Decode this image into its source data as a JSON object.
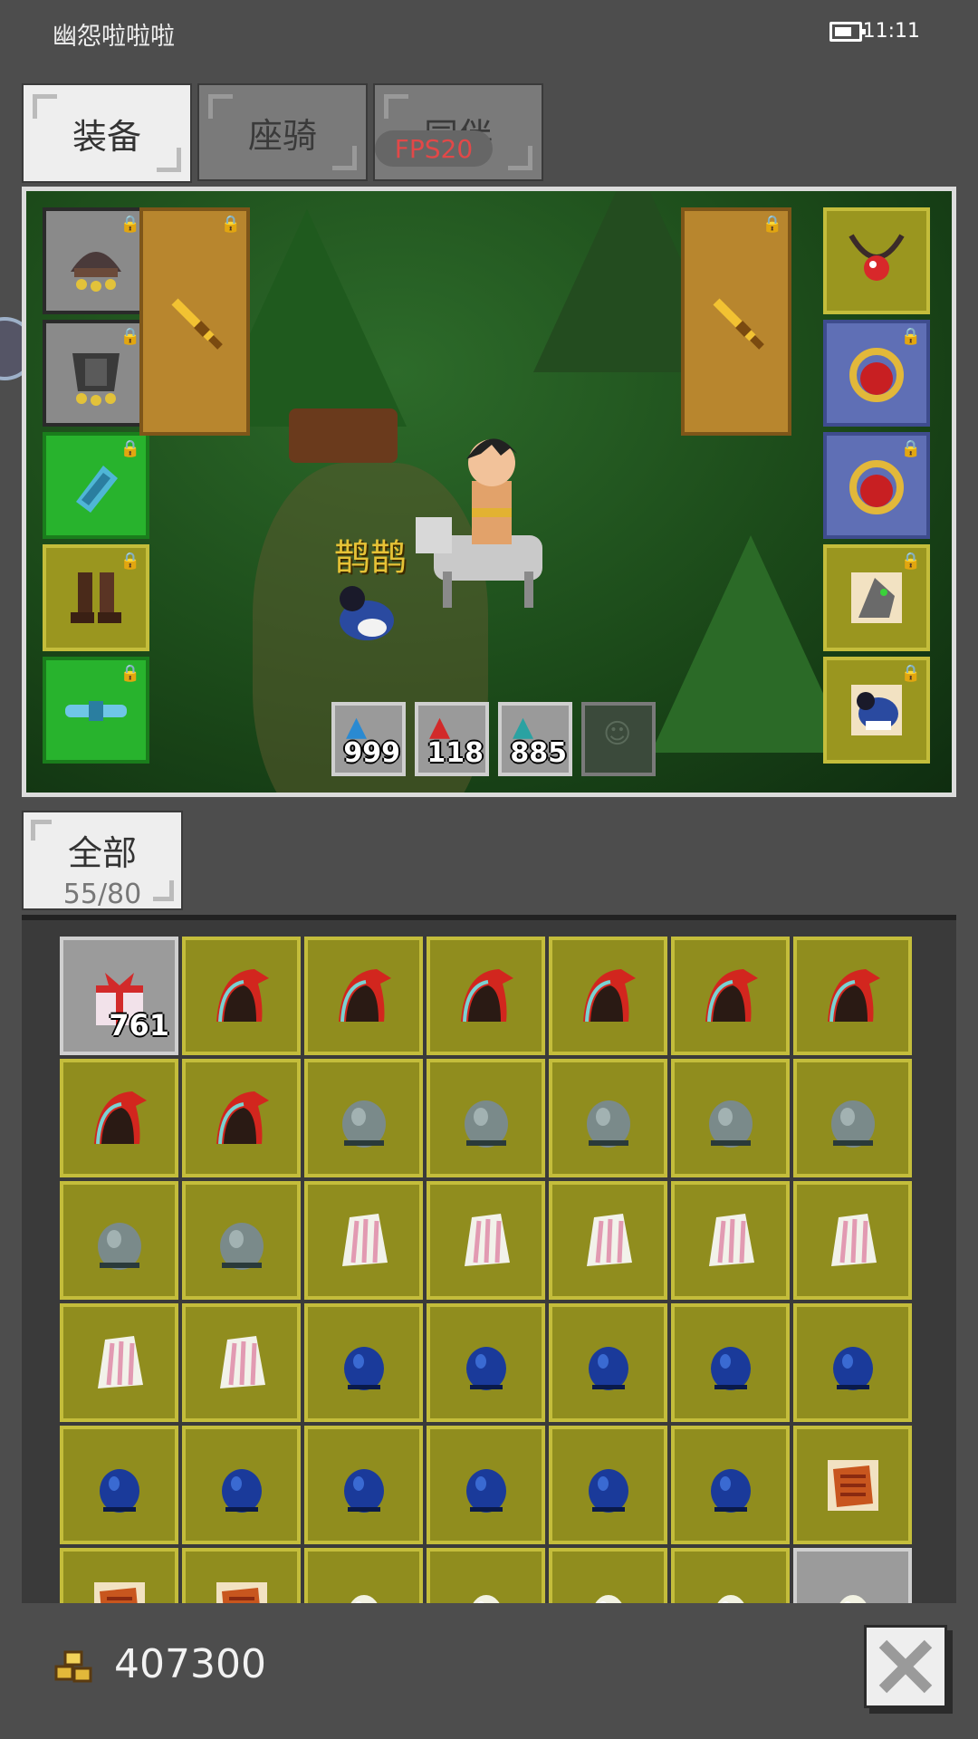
{
  "status": {
    "app_name": "幽怨啦啦啦",
    "time": "11:11"
  },
  "tabs": [
    {
      "label": "装备",
      "active": true
    },
    {
      "label": "座骑",
      "active": false
    },
    {
      "label": "同伴",
      "active": false
    }
  ],
  "fps": "FPS20",
  "scene": {
    "pet_name": "鹊鹊",
    "left_slots": [
      "helmet-icon",
      "armor-icon",
      "bracer-icon",
      "boots-icon",
      "belt-icon"
    ],
    "right_slots": [
      "necklace-icon",
      "ring-icon",
      "ring-icon",
      "mount-icon",
      "pet-icon"
    ],
    "quick_items": [
      {
        "icon": "potion-blue-icon",
        "count": "999"
      },
      {
        "icon": "potion-red-icon",
        "count": "118"
      },
      {
        "icon": "potion-teal-icon",
        "count": "885"
      },
      {
        "icon": "empty-slot-icon",
        "count": ""
      }
    ]
  },
  "filter": {
    "label": "全部",
    "capacity": "55/80"
  },
  "inventory": [
    {
      "icon": "gift-box-icon",
      "count": "761",
      "bg": "grey"
    },
    {
      "icon": "red-hat-icon"
    },
    {
      "icon": "red-hat-icon"
    },
    {
      "icon": "red-hat-icon"
    },
    {
      "icon": "red-hat-icon"
    },
    {
      "icon": "red-hat-icon"
    },
    {
      "icon": "red-hat-icon"
    },
    {
      "icon": "red-hat-icon"
    },
    {
      "icon": "red-hat-icon"
    },
    {
      "icon": "grey-stone-icon"
    },
    {
      "icon": "grey-stone-icon"
    },
    {
      "icon": "grey-stone-icon"
    },
    {
      "icon": "grey-stone-icon"
    },
    {
      "icon": "grey-stone-icon"
    },
    {
      "icon": "grey-stone-icon"
    },
    {
      "icon": "grey-stone-icon"
    },
    {
      "icon": "feather-icon"
    },
    {
      "icon": "feather-icon"
    },
    {
      "icon": "feather-icon"
    },
    {
      "icon": "feather-icon"
    },
    {
      "icon": "feather-icon"
    },
    {
      "icon": "feather-icon"
    },
    {
      "icon": "feather-icon"
    },
    {
      "icon": "blue-gem-icon"
    },
    {
      "icon": "blue-gem-icon"
    },
    {
      "icon": "blue-gem-icon"
    },
    {
      "icon": "blue-gem-icon"
    },
    {
      "icon": "blue-gem-icon"
    },
    {
      "icon": "blue-gem-icon"
    },
    {
      "icon": "blue-gem-icon"
    },
    {
      "icon": "blue-gem-icon"
    },
    {
      "icon": "blue-gem-icon"
    },
    {
      "icon": "blue-gem-icon"
    },
    {
      "icon": "blue-gem-icon"
    },
    {
      "icon": "scroll-icon"
    },
    {
      "icon": "scroll-icon"
    },
    {
      "icon": "scroll-icon"
    },
    {
      "icon": "egg-icon"
    },
    {
      "icon": "egg-icon"
    },
    {
      "icon": "egg-icon"
    },
    {
      "icon": "egg-icon"
    },
    {
      "icon": "egg-icon",
      "bg": "grey"
    }
  ],
  "gold": "407300",
  "colors": {
    "background": "#4d4d4d",
    "slot_olive": "#908d1e",
    "slot_green": "#28b32d",
    "slot_blue": "#5f6fb5",
    "weapon_slot": "#b8862e",
    "fps_text": "#e24848",
    "pet_name": "#e6c236"
  }
}
